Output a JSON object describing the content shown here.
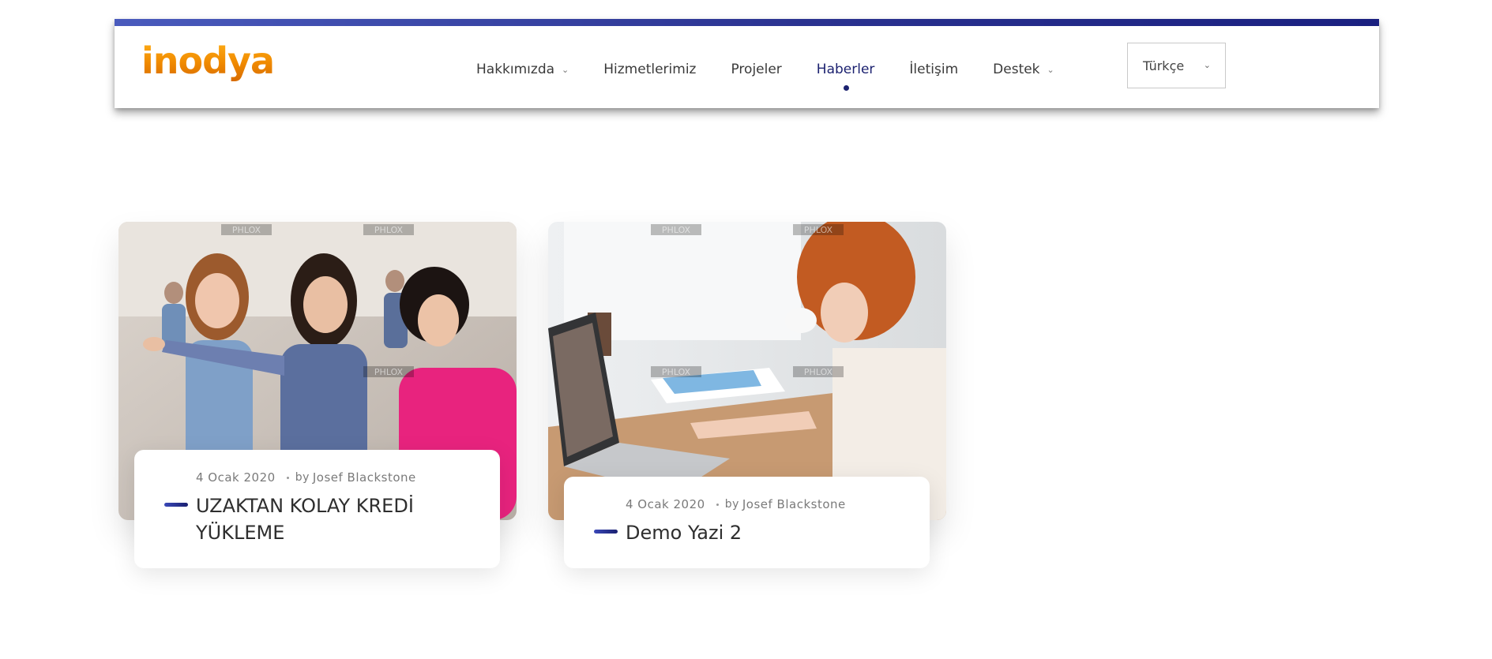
{
  "header": {
    "logo": "inodya",
    "nav": [
      {
        "label": "Hakkımızda",
        "has_dropdown": true,
        "active": false
      },
      {
        "label": "Hizmetlerimiz",
        "has_dropdown": false,
        "active": false
      },
      {
        "label": "Projeler",
        "has_dropdown": false,
        "active": false
      },
      {
        "label": "Haberler",
        "has_dropdown": false,
        "active": true
      },
      {
        "label": "İletişim",
        "has_dropdown": false,
        "active": false
      },
      {
        "label": "Destek",
        "has_dropdown": true,
        "active": false
      }
    ],
    "language": "Türkçe",
    "colors": {
      "accent": "#1c2270",
      "logo": "#f08a00"
    }
  },
  "posts": [
    {
      "date": "4 Ocak 2020",
      "by": "by",
      "author": "Josef Blackstone",
      "title": "UZAKTAN KOLAY KREDİ YÜKLEME",
      "image_alt": "photo-three-women-office"
    },
    {
      "date": "4 Ocak 2020",
      "by": "by",
      "author": "Josef Blackstone",
      "title": "Demo Yazi 2",
      "image_alt": "photo-woman-laptop-coffee"
    }
  ],
  "watermark": "PHLOX"
}
